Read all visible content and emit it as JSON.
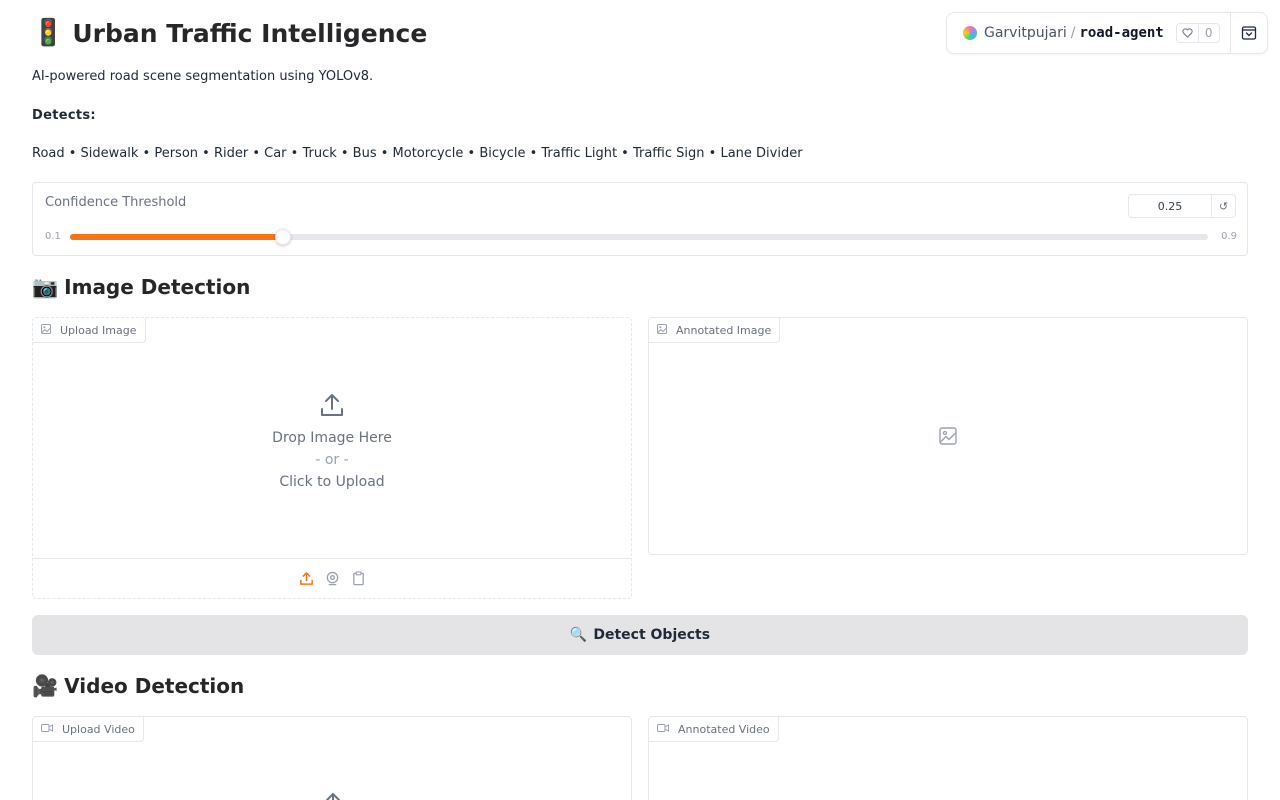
{
  "header": {
    "title_emoji": "🚦",
    "title": "Urban Traffic Intelligence",
    "subtitle": "AI-powered road scene segmentation using YOLOv8.",
    "detects_label": "Detects:",
    "detects_list": "Road • Sidewalk • Person • Rider • Car • Truck • Bus • Motorcycle • Bicycle • Traffic Light • Traffic Sign • Lane Divider"
  },
  "hf_badge": {
    "owner": "Garvitpujari",
    "separator": "/",
    "repo": "road-agent",
    "likes": "0"
  },
  "slider": {
    "label": "Confidence Threshold",
    "value": "0.25",
    "min_label": "0.1",
    "max_label": "0.9",
    "value_fraction": 0.1875,
    "reset_icon": "↺",
    "fill_color": "#f97316"
  },
  "image_section": {
    "emoji": "📷",
    "title": "Image Detection",
    "upload_label": "Upload Image",
    "drop_text": "Drop Image Here",
    "or_text": "- or -",
    "click_text": "Click to Upload",
    "output_label": "Annotated Image"
  },
  "detect_button": {
    "emoji": "🔍",
    "label": "Detect Objects"
  },
  "video_section": {
    "emoji": "🎥",
    "title": "Video Detection",
    "upload_label": "Upload Video",
    "output_label": "Annotated Video"
  },
  "icons": {
    "upload": "upload-icon",
    "webcam": "webcam-icon",
    "clipboard": "clipboard-icon",
    "image": "image-icon",
    "video": "video-icon",
    "heart": "heart-icon",
    "collapse": "collapse-icon"
  },
  "colors": {
    "accent": "#f97316",
    "button_bg": "#e4e4e7"
  }
}
